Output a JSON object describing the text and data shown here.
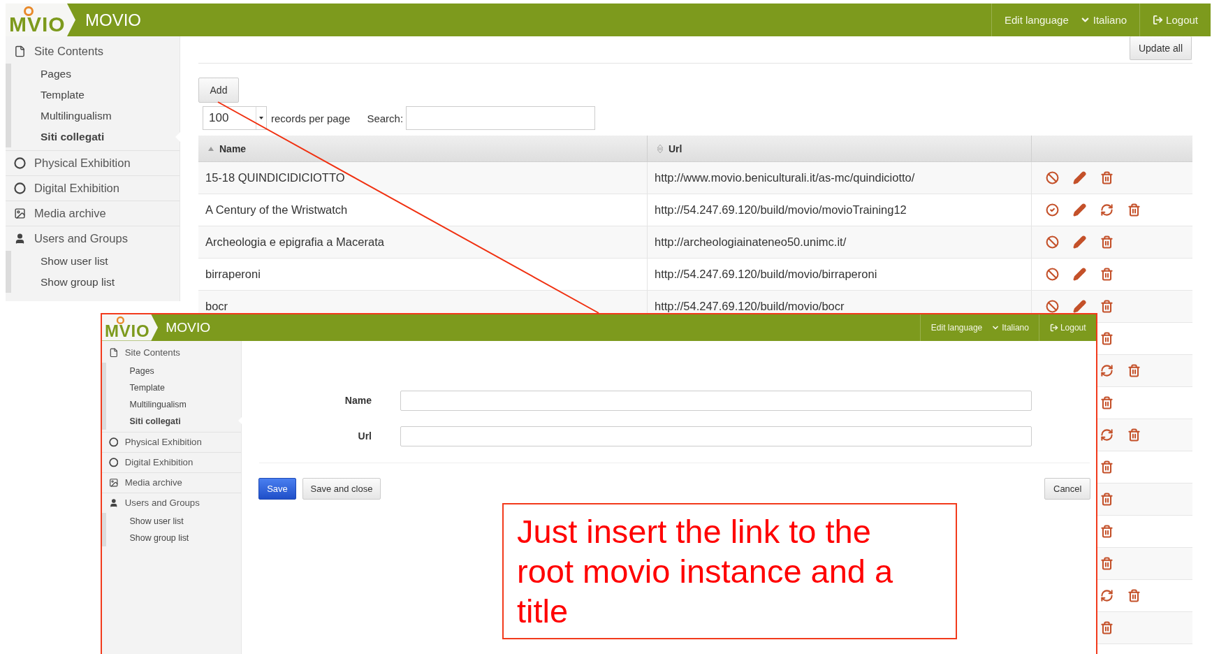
{
  "header": {
    "logo": "MVIO",
    "title": "MOVIO",
    "edit_language": "Edit language",
    "language": "Italiano",
    "logout": "Logout"
  },
  "sidebar": {
    "items": [
      {
        "label": "Site Contents",
        "kind": "page",
        "children": [
          {
            "label": "Pages",
            "selected": false
          },
          {
            "label": "Template",
            "selected": false
          },
          {
            "label": "Multilingualism",
            "selected": false
          },
          {
            "label": "Siti collegati",
            "selected": true
          }
        ]
      },
      {
        "label": "Physical Exhibition",
        "kind": "circle"
      },
      {
        "label": "Digital Exhibition",
        "kind": "circle"
      },
      {
        "label": "Media archive",
        "kind": "image"
      },
      {
        "label": "Users and Groups",
        "kind": "user",
        "children": [
          {
            "label": "Show user list",
            "selected": false
          },
          {
            "label": "Show group list",
            "selected": false
          }
        ]
      }
    ]
  },
  "toolbar": {
    "update_all": "Update all",
    "add": "Add",
    "page_size": "100",
    "page_size_label": "records per page",
    "search_label": "Search:"
  },
  "table": {
    "columns": [
      {
        "label": "Name",
        "kind": "sorted"
      },
      {
        "label": "Url",
        "kind": "sortable"
      }
    ],
    "rows": [
      {
        "name": "15-18 QUINDICIDICIOTTO",
        "url": "http://www.movio.beniculturali.it/as-mc/quindiciotto/",
        "actions": [
          {
            "kind": "disable"
          },
          {
            "kind": "edit"
          },
          {
            "kind": "delete"
          }
        ]
      },
      {
        "name": "A Century of the Wristwatch",
        "url": "http://54.247.69.120/build/movio/movioTraining12",
        "actions": [
          {
            "kind": "enable"
          },
          {
            "kind": "edit"
          },
          {
            "kind": "refresh"
          },
          {
            "kind": "delete"
          }
        ]
      },
      {
        "name": "Archeologia e epigrafia a Macerata",
        "url": "http://archeologiainateneo50.unimc.it/",
        "actions": [
          {
            "kind": "disable"
          },
          {
            "kind": "edit"
          },
          {
            "kind": "delete"
          }
        ]
      },
      {
        "name": "birraperoni",
        "url": "http://54.247.69.120/build/movio/birraperoni",
        "actions": [
          {
            "kind": "disable"
          },
          {
            "kind": "edit"
          },
          {
            "kind": "delete"
          }
        ]
      },
      {
        "name": "bocr",
        "url": "http://54.247.69.120/build/movio/bocr",
        "actions": [
          {
            "kind": "disable"
          },
          {
            "kind": "edit"
          },
          {
            "kind": "delete"
          }
        ]
      },
      {
        "actions": [
          {
            "kind": "delete"
          }
        ]
      },
      {
        "actions": [
          {
            "kind": "refresh"
          },
          {
            "kind": "delete"
          }
        ]
      },
      {
        "actions": [
          {
            "kind": "delete"
          }
        ]
      },
      {
        "actions": [
          {
            "kind": "refresh"
          },
          {
            "kind": "delete"
          }
        ]
      },
      {
        "actions": [
          {
            "kind": "delete"
          }
        ]
      },
      {
        "actions": [
          {
            "kind": "delete"
          }
        ]
      },
      {
        "actions": [
          {
            "kind": "delete"
          }
        ]
      },
      {
        "actions": [
          {
            "kind": "delete"
          }
        ]
      },
      {
        "actions": [
          {
            "kind": "refresh"
          },
          {
            "kind": "delete"
          }
        ]
      },
      {
        "actions": [
          {
            "kind": "delete"
          }
        ]
      }
    ]
  },
  "dialog": {
    "header": {
      "logo": "MVIO",
      "title": "MOVIO",
      "edit_language": "Edit language",
      "language": "Italiano",
      "logout": "Logout"
    },
    "sidebar": {
      "items": [
        {
          "label": "Site Contents",
          "kind": "page",
          "children": [
            {
              "label": "Pages",
              "selected": false
            },
            {
              "label": "Template",
              "selected": false
            },
            {
              "label": "Multilingualism",
              "selected": false
            },
            {
              "label": "Siti collegati",
              "selected": true
            }
          ]
        },
        {
          "label": "Physical Exhibition",
          "kind": "circle"
        },
        {
          "label": "Digital Exhibition",
          "kind": "circle"
        },
        {
          "label": "Media archive",
          "kind": "image"
        },
        {
          "label": "Users and Groups",
          "kind": "user",
          "children": [
            {
              "label": "Show user list",
              "selected": false
            },
            {
              "label": "Show group list",
              "selected": false
            }
          ]
        }
      ]
    },
    "fields": [
      {
        "label": "Name"
      },
      {
        "label": "Url"
      }
    ],
    "buttons": [
      {
        "label": "Save",
        "kind": "primary"
      },
      {
        "label": "Save and close",
        "kind": "default"
      }
    ],
    "cancel": "Cancel"
  },
  "callout": {
    "text": "Just insert the link to the root movio instance and a title"
  }
}
